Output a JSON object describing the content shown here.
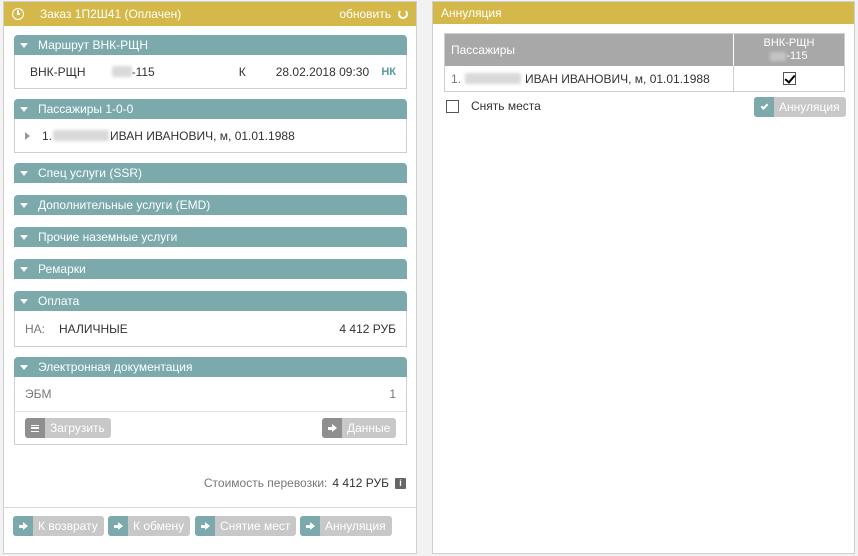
{
  "order": {
    "title": "Заказ 1П2Ш41 (Оплачен)",
    "refresh_label": "обновить"
  },
  "sections": {
    "route": {
      "title": "Маршрут ВНК-РЩН",
      "from_to": "ВНК-РЩН",
      "flight_suffix": "-115",
      "class": "К",
      "datetime": "28.02.2018 09:30",
      "status": "НК"
    },
    "passengers": {
      "title": "Пассажиры 1-0-0",
      "item": "ИВАН ИВАНОВИЧ, м, 01.01.1988",
      "item_num": "1."
    },
    "ssr": {
      "title": "Спец услуги (SSR)"
    },
    "emd": {
      "title": "Дополнительные услуги (EMD)"
    },
    "ground": {
      "title": "Прочие наземные услуги"
    },
    "remarks": {
      "title": "Ремарки"
    },
    "payment": {
      "title": "Оплата",
      "label": "НА:",
      "method": "НАЛИЧНЫЕ",
      "amount": "4 412 РУБ"
    },
    "edoc": {
      "title": "Электронная документация",
      "label": "ЭБМ",
      "count": "1",
      "load_button": "Загрузить",
      "data_button": "Данные"
    }
  },
  "cost": {
    "label": "Стоимость перевозки:",
    "value": "4 412 РУБ"
  },
  "footer_buttons": {
    "refund": "К возврату",
    "exchange": "К обмену",
    "unseat": "Снятие мест",
    "cancel": "Аннуляция"
  },
  "annul": {
    "title": "Аннуляция",
    "col_passengers": "Пассажиры",
    "col_route": "ВНК-РЩН",
    "col_flight": "-115",
    "row_num": "1.",
    "row_text": "ИВАН ИВАНОВИЧ, м, 01.01.1988",
    "remove_seats_label": "Снять места",
    "annul_button": "Аннуляция"
  },
  "colors": {
    "header": "#d4b84a",
    "section": "#7ba9ac",
    "button": "#c8c8c8"
  }
}
